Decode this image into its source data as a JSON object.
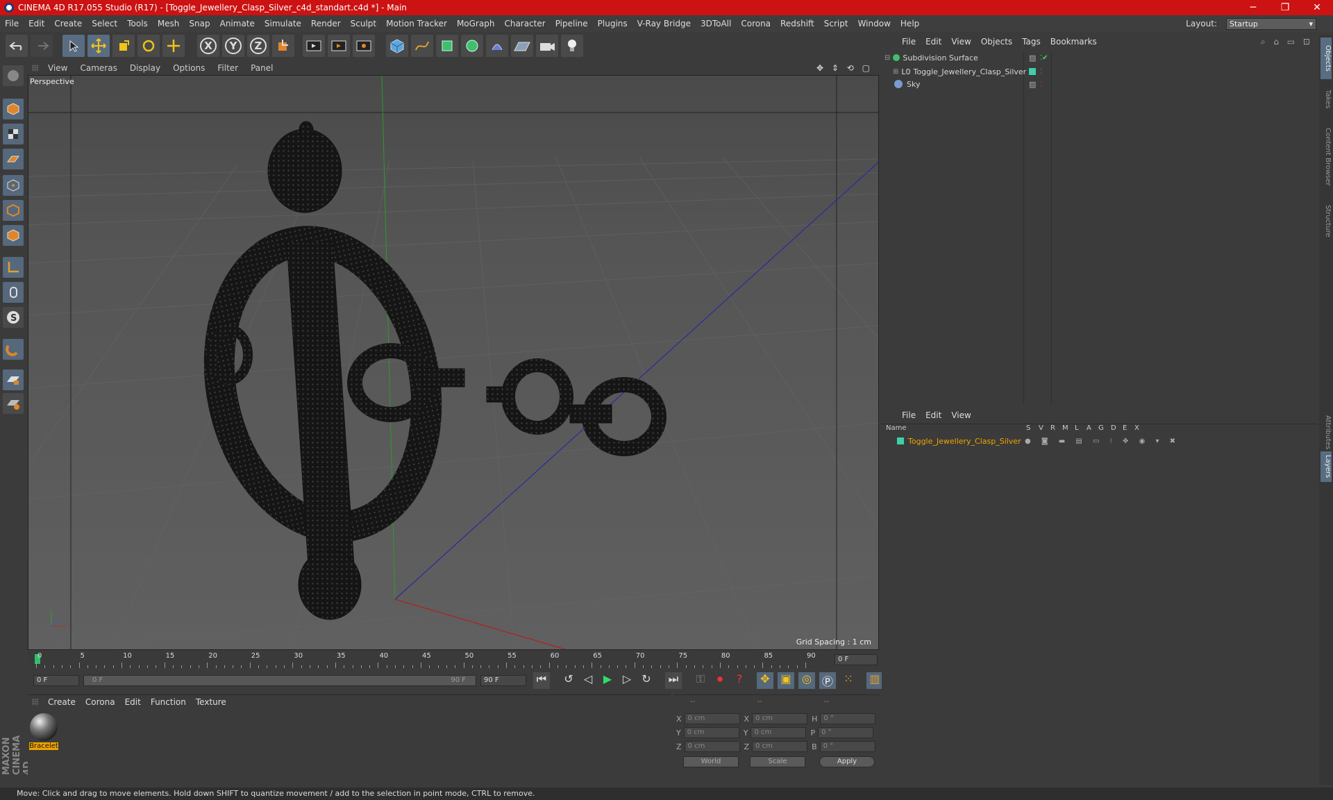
{
  "window": {
    "title": "CINEMA 4D R17.055 Studio (R17) - [Toggle_Jewellery_Clasp_Silver_c4d_standart.c4d *] - Main",
    "controls": [
      "─",
      "❐",
      "✕"
    ]
  },
  "menubar": {
    "items": [
      "File",
      "Edit",
      "Create",
      "Select",
      "Tools",
      "Mesh",
      "Snap",
      "Animate",
      "Simulate",
      "Render",
      "Sculpt",
      "Motion Tracker",
      "MoGraph",
      "Character",
      "Pipeline",
      "Plugins",
      "V-Ray Bridge",
      "3DToAll",
      "Corona",
      "Redshift",
      "Script",
      "Window",
      "Help"
    ],
    "layout_label": "Layout:",
    "layout_value": "Startup"
  },
  "toolbar": {
    "axis_labels": [
      "X",
      "Y",
      "Z"
    ]
  },
  "viewport": {
    "menu": [
      "View",
      "Cameras",
      "Display",
      "Options",
      "Filter",
      "Panel"
    ],
    "camera_label": "Perspective",
    "grid_spacing": "Grid Spacing : 1 cm"
  },
  "timeline": {
    "ticks": [
      "0",
      "5",
      "10",
      "15",
      "20",
      "25",
      "30",
      "35",
      "40",
      "45",
      "50",
      "55",
      "60",
      "65",
      "70",
      "75",
      "80",
      "85",
      "90"
    ],
    "current_frame": "0 F"
  },
  "transport": {
    "start_field": "0 F",
    "range_start": "0 F",
    "range_end": "90 F",
    "end_field": "90 F"
  },
  "materials": {
    "menu": [
      "Create",
      "Corona",
      "Edit",
      "Function",
      "Texture"
    ],
    "items": [
      {
        "name": "Bracelet"
      }
    ]
  },
  "coordinates": {
    "headers": [
      "--",
      "--",
      "--"
    ],
    "rows": [
      {
        "a": "X",
        "pos": "0 cm",
        "b": "X",
        "size": "0 cm",
        "c": "H",
        "rot": "0 °"
      },
      {
        "a": "Y",
        "pos": "0 cm",
        "b": "Y",
        "size": "0 cm",
        "c": "P",
        "rot": "0 °"
      },
      {
        "a": "Z",
        "pos": "0 cm",
        "b": "Z",
        "size": "0 cm",
        "c": "B",
        "rot": "0 °"
      }
    ],
    "world_select": "World",
    "scale_select": "Scale",
    "apply_label": "Apply"
  },
  "objects_panel": {
    "menu": [
      "File",
      "Edit",
      "View",
      "Objects",
      "Tags",
      "Bookmarks"
    ],
    "items": [
      {
        "name": "Subdivision Surface",
        "color": "#d6d6d6"
      },
      {
        "name": "Toggle_Jewellery_Clasp_Silver",
        "color": "#d6d6d6"
      },
      {
        "name": "Sky",
        "color": "#d6d6d6"
      }
    ]
  },
  "layers_panel": {
    "menu": [
      "File",
      "Edit",
      "View"
    ],
    "columns": [
      "Name",
      "S",
      "V",
      "R",
      "M",
      "L",
      "A",
      "G",
      "D",
      "E",
      "X"
    ],
    "items": [
      {
        "name": "Toggle_Jewellery_Clasp_Silver",
        "color": "#f0a500"
      }
    ]
  },
  "right_tabs": [
    "Objects",
    "Takes",
    "Content Browser",
    "Structure",
    "Attributes",
    "Layers"
  ],
  "status": {
    "text": "Move: Click and drag to move elements. Hold down SHIFT to quantize movement / add to the selection in point mode, CTRL to remove."
  },
  "brand": "MAXON CINEMA 4D",
  "colors": {
    "titlebar": "#cc1212",
    "active_tool": "#596d82",
    "layer_name": "#f0a500",
    "layer_swatch": "#3fd0a8"
  }
}
